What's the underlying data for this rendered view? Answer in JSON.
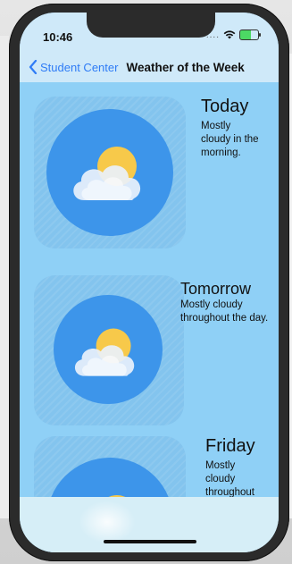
{
  "status": {
    "time": "10:46",
    "signal": "....",
    "battery_color": "#4cd964"
  },
  "nav": {
    "back_label": "Student Center",
    "title": "Weather of the Week",
    "accent": "#2f7cf6"
  },
  "days": [
    {
      "name": "Today",
      "description": "Mostly cloudy in the morning.",
      "icon": "partly-cloudy-icon"
    },
    {
      "name": "Tomorrow",
      "description": "Mostly cloudy throughout the day.",
      "icon": "partly-cloudy-icon"
    },
    {
      "name": "Friday",
      "description": "Mostly cloudy throughout the day.",
      "icon": "partly-cloudy-icon"
    }
  ],
  "colors": {
    "background": "#8fd0f6",
    "bar": "#cfe9f9",
    "circle": "#3d95ea",
    "sun": "#f7c94a"
  }
}
